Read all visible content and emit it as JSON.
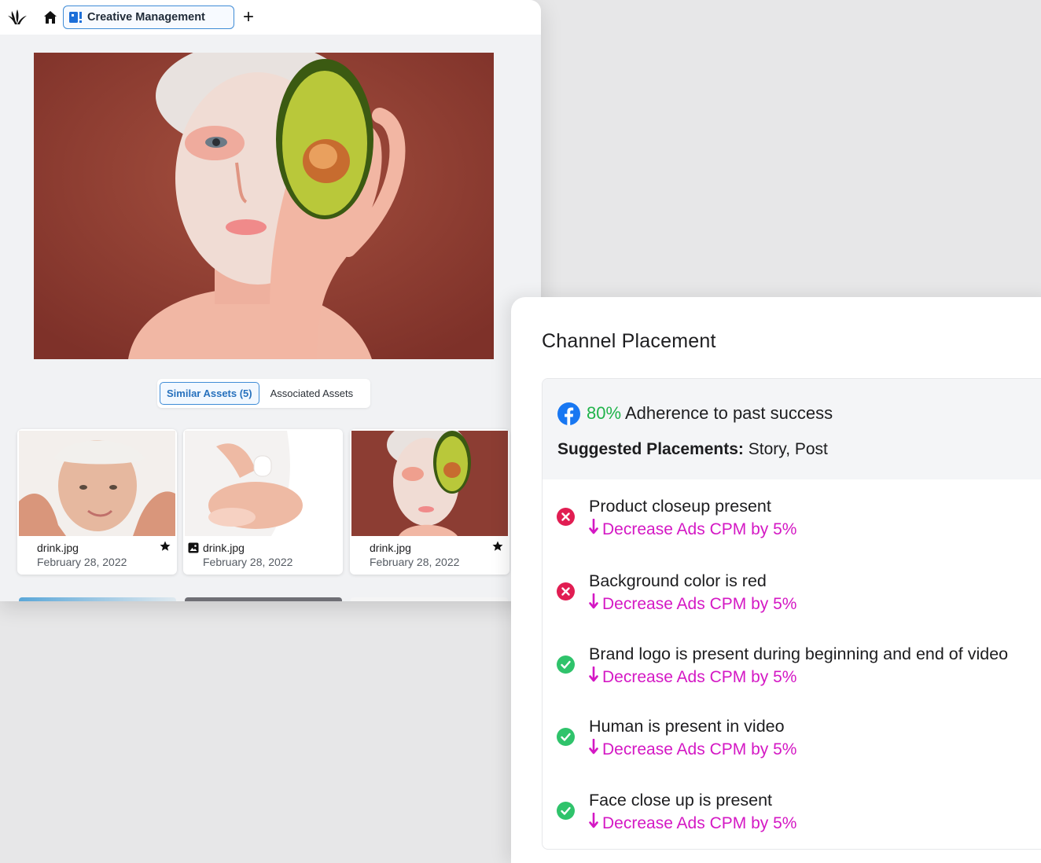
{
  "app": {
    "tab_title": "Creative Management",
    "add_tab_label": "+"
  },
  "asset_tabs": {
    "similar": "Similar Assets (5)",
    "associated": "Associated Assets"
  },
  "assets": [
    {
      "file": "drink.jpg",
      "date": "February 28, 2022",
      "starred": true,
      "type_icon": false
    },
    {
      "file": "drink.jpg",
      "date": "February 28, 2022",
      "starred": false,
      "type_icon": true
    },
    {
      "file": "drink.jpg",
      "date": "February 28, 2022",
      "starred": true,
      "type_icon": false
    }
  ],
  "panel": {
    "title": "Channel Placement",
    "adherence_pct": "80%",
    "adherence_text": "Adherence to past success",
    "placements_label": "Suggested Placements:",
    "placements_value": "Story, Post",
    "rules": [
      {
        "title": "Product closeup present",
        "impact": "Decrease Ads CPM by 5%",
        "status": "fail"
      },
      {
        "title": "Background color is red",
        "impact": "Decrease Ads CPM by 5%",
        "status": "fail"
      },
      {
        "title": "Brand logo is present during beginning and end of video",
        "impact": "Decrease Ads CPM by 5%",
        "status": "pass"
      },
      {
        "title": "Human is present in video",
        "impact": "Decrease Ads CPM by 5%",
        "status": "pass"
      },
      {
        "title": "Face close up is present",
        "impact": "Decrease Ads CPM by 5%",
        "status": "pass"
      }
    ]
  },
  "colors": {
    "accent_blue": "#3f8cd6",
    "success_green": "#1fb34a",
    "impact_magenta": "#d418c4",
    "fail_red": "#e11d52",
    "pass_green": "#2fc36b",
    "facebook_blue": "#1877f2"
  }
}
